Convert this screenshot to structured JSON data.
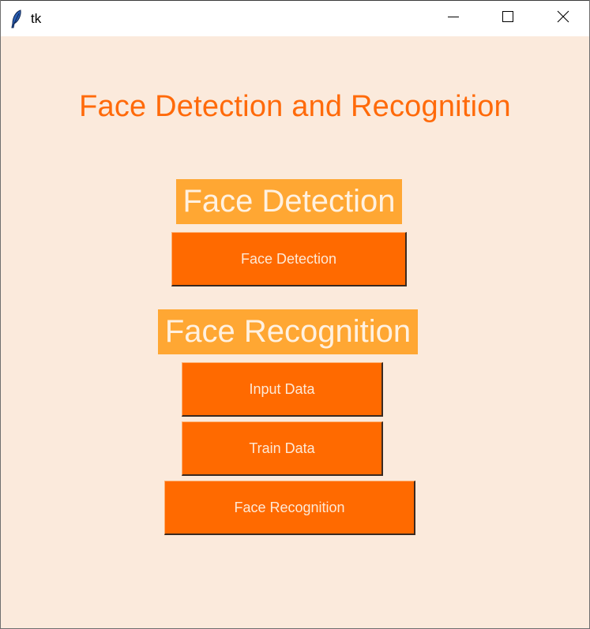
{
  "window": {
    "title": "tk"
  },
  "main": {
    "title": "Face Detection and Recognition",
    "detection_section": {
      "label": "Face Detection",
      "button_label": "Face Detection"
    },
    "recognition_section": {
      "label": "Face Recognition",
      "input_button_label": "Input Data",
      "train_button_label": "Train Data",
      "recognize_button_label": "Face Recognition"
    }
  },
  "colors": {
    "background": "#fbeadc",
    "title_text": "#ff6a0a",
    "section_label_bg": "#ffa733",
    "section_label_text": "#fff1e0",
    "button_bg": "#ff6a00",
    "button_text": "#fde9d6"
  },
  "icons": {
    "app": "feather-icon",
    "minimize": "minimize-icon",
    "maximize": "maximize-icon",
    "close": "close-icon"
  }
}
